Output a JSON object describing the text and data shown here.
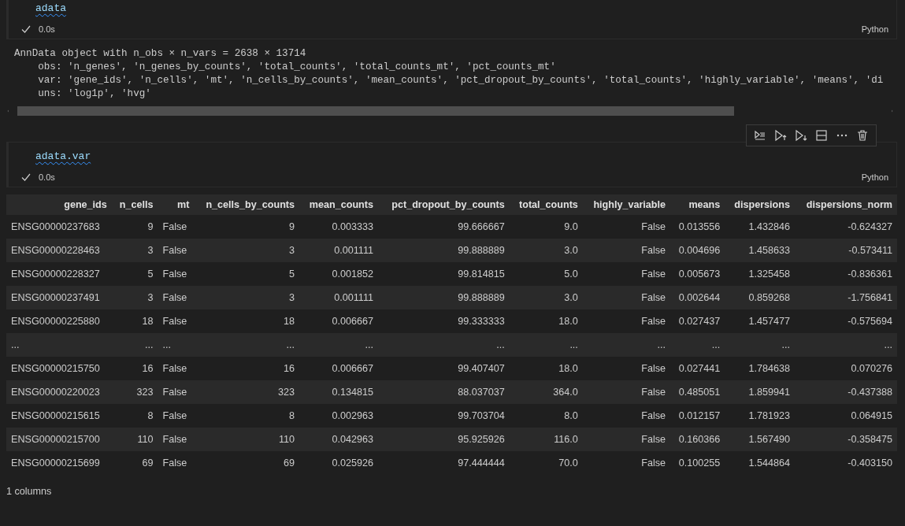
{
  "cells": [
    {
      "code": "adata",
      "status": "0.0s",
      "language": "Python",
      "toolbar": false,
      "output": {
        "kind": "text",
        "lines": [
          "AnnData object with n_obs × n_vars = 2638 × 13714",
          "    obs: 'n_genes', 'n_genes_by_counts', 'total_counts', 'total_counts_mt', 'pct_counts_mt'",
          "    var: 'gene_ids', 'n_cells', 'mt', 'n_cells_by_counts', 'mean_counts', 'pct_dropout_by_counts', 'total_counts', 'highly_variable', 'means', 'di",
          "    uns: 'log1p', 'hvg'"
        ]
      }
    },
    {
      "code": "adata.var",
      "status": "0.0s",
      "language": "Python",
      "toolbar": true,
      "output": {
        "kind": "table",
        "columns": [
          "gene_ids",
          "n_cells",
          "mt",
          "n_cells_by_counts",
          "mean_counts",
          "pct_dropout_by_counts",
          "total_counts",
          "highly_variable",
          "means",
          "dispersions",
          "dispersions_norm"
        ],
        "rows": [
          [
            "ENSG00000237683",
            "9",
            "False",
            "9",
            "0.003333",
            "99.666667",
            "9.0",
            "False",
            "0.013556",
            "1.432846",
            "-0.624327"
          ],
          [
            "ENSG00000228463",
            "3",
            "False",
            "3",
            "0.001111",
            "99.888889",
            "3.0",
            "False",
            "0.004696",
            "1.458633",
            "-0.573411"
          ],
          [
            "ENSG00000228327",
            "5",
            "False",
            "5",
            "0.001852",
            "99.814815",
            "5.0",
            "False",
            "0.005673",
            "1.325458",
            "-0.836361"
          ],
          [
            "ENSG00000237491",
            "3",
            "False",
            "3",
            "0.001111",
            "99.888889",
            "3.0",
            "False",
            "0.002644",
            "0.859268",
            "-1.756841"
          ],
          [
            "ENSG00000225880",
            "18",
            "False",
            "18",
            "0.006667",
            "99.333333",
            "18.0",
            "False",
            "0.027437",
            "1.457477",
            "-0.575694"
          ],
          [
            "...",
            "...",
            "...",
            "...",
            "...",
            "...",
            "...",
            "...",
            "...",
            "...",
            "..."
          ],
          [
            "ENSG00000215750",
            "16",
            "False",
            "16",
            "0.006667",
            "99.407407",
            "18.0",
            "False",
            "0.027441",
            "1.784638",
            "0.070276"
          ],
          [
            "ENSG00000220023",
            "323",
            "False",
            "323",
            "0.134815",
            "88.037037",
            "364.0",
            "False",
            "0.485051",
            "1.859941",
            "-0.437388"
          ],
          [
            "ENSG00000215615",
            "8",
            "False",
            "8",
            "0.002963",
            "99.703704",
            "8.0",
            "False",
            "0.012157",
            "1.781923",
            "0.064915"
          ],
          [
            "ENSG00000215700",
            "110",
            "False",
            "110",
            "0.042963",
            "95.925926",
            "116.0",
            "False",
            "0.160366",
            "1.567490",
            "-0.358475"
          ],
          [
            "ENSG00000215699",
            "69",
            "False",
            "69",
            "0.025926",
            "97.444444",
            "70.0",
            "False",
            "0.100255",
            "1.544864",
            "-0.403150"
          ]
        ],
        "footer": "1 columns"
      }
    }
  ]
}
